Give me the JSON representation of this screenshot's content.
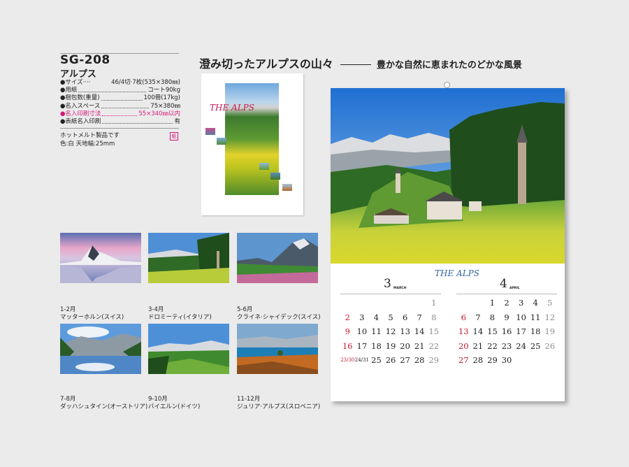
{
  "product": {
    "model": "SG-208",
    "name": "アルプス",
    "specs": [
      {
        "label": "●サイズ····",
        "value": "46/4切·7枚(535×380㎜)",
        "dotted": false,
        "highlight": false
      },
      {
        "label": "●用紙",
        "value": "コート90kg",
        "dotted": true,
        "highlight": false
      },
      {
        "label": "●梱包数(重量)",
        "value": "100冊(17kg)",
        "dotted": true,
        "highlight": false
      },
      {
        "label": "●名入スペース",
        "value": "75×380㎜",
        "dotted": true,
        "highlight": false
      },
      {
        "label": "●名入印刷寸法",
        "value": "55×340㎜以内",
        "dotted": true,
        "highlight": true
      },
      {
        "label": "●表紙名入印刷",
        "value": "有",
        "dotted": true,
        "highlight": false
      }
    ],
    "notes": [
      "ホットメルト製品です",
      "色:白 天地幅:25mm"
    ],
    "badge": "紙"
  },
  "headline": {
    "main": "澄み切ったアルプスの山々",
    "sub": "豊かな自然に恵まれたのどかな風景"
  },
  "mini_calendar": {
    "title": "THE ALPS"
  },
  "big_calendar": {
    "logo": "THE ALPS",
    "months": [
      {
        "num": "3",
        "en": "MARCH",
        "rows": [
          [
            "",
            "",
            "",
            "",
            "",
            "",
            "1"
          ],
          [
            "2",
            "3",
            "4",
            "5",
            "6",
            "7",
            "8"
          ],
          [
            "9",
            "10",
            "11",
            "12",
            "13",
            "14",
            "15"
          ],
          [
            "16",
            "17",
            "18",
            "19",
            "20",
            "21",
            "22"
          ],
          [
            "23/30",
            "24/31",
            "25",
            "26",
            "27",
            "28",
            "29"
          ]
        ]
      },
      {
        "num": "4",
        "en": "APRIL",
        "rows": [
          [
            "",
            "",
            "1",
            "2",
            "3",
            "4",
            "5"
          ],
          [
            "6",
            "7",
            "8",
            "9",
            "10",
            "11",
            "12"
          ],
          [
            "13",
            "14",
            "15",
            "16",
            "17",
            "18",
            "19"
          ],
          [
            "20",
            "21",
            "22",
            "23",
            "24",
            "25",
            "26"
          ],
          [
            "27",
            "28",
            "29",
            "30",
            "",
            "",
            ""
          ]
        ]
      }
    ]
  },
  "thumbnails": [
    {
      "months": "1-2月",
      "place": "マッターホルン(スイス)"
    },
    {
      "months": "3-4月",
      "place": "ドロミーティ(イタリア)"
    },
    {
      "months": "5-6月",
      "place": "クライネ·シャイデック(スイス)"
    },
    {
      "months": "7-8月",
      "place": "ダッハシュタイン(オーストリア)"
    },
    {
      "months": "9-10月",
      "place": "バイエルン(ドイツ)"
    },
    {
      "months": "11-12月",
      "place": "ジュリア·アルプス(スロベニア)"
    }
  ]
}
